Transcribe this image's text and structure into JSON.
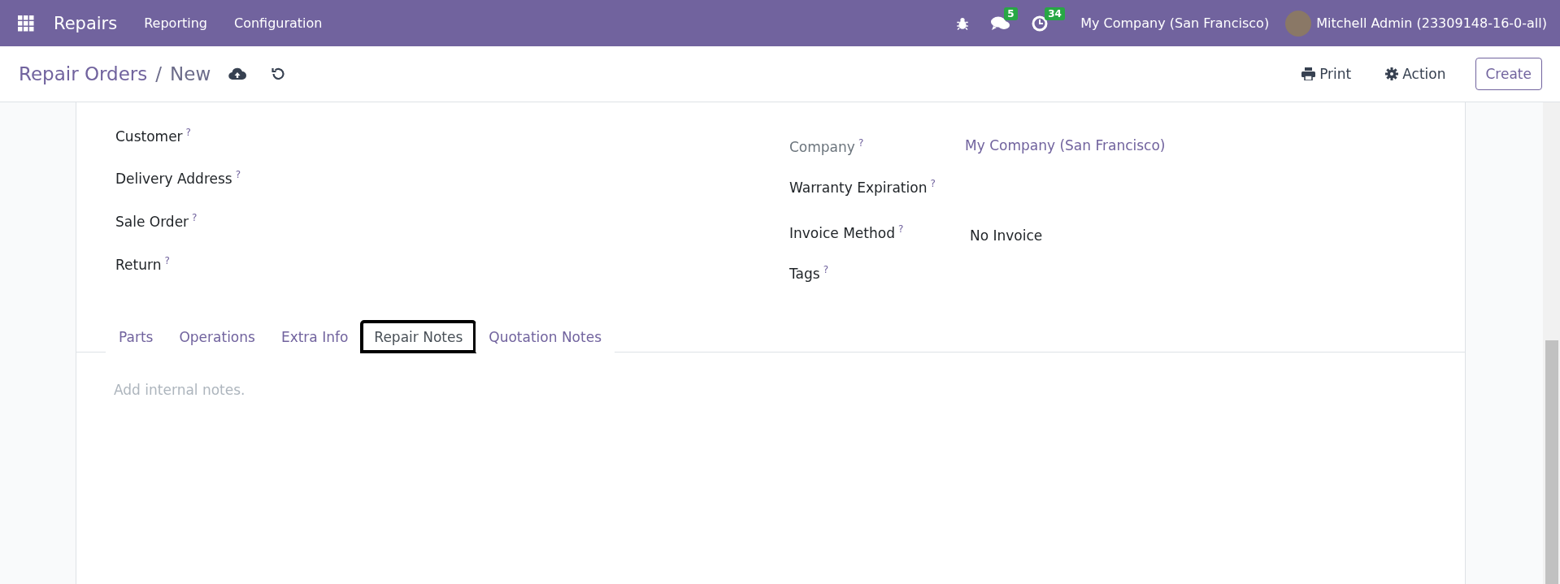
{
  "navbar": {
    "app": "Repairs",
    "menus": [
      "Reporting",
      "Configuration"
    ],
    "messages_count": "5",
    "activities_count": "34",
    "company": "My Company (San Francisco)",
    "user": "Mitchell Admin (23309148-16-0-all)"
  },
  "control_panel": {
    "breadcrumb": "Repair Orders",
    "separator": "/",
    "current": "New",
    "print": "Print",
    "action": "Action",
    "create": "Create"
  },
  "form": {
    "left_fields": [
      {
        "label": "Customer",
        "help": "?"
      },
      {
        "label": "Delivery Address",
        "help": "?"
      },
      {
        "label": "Sale Order",
        "help": "?"
      },
      {
        "label": "Return",
        "help": "?"
      }
    ],
    "right_fields": [
      {
        "label": "Company",
        "help": "?",
        "value": "My Company (San Francisco)",
        "kind": "link"
      },
      {
        "label": "Warranty Expiration",
        "help": "?",
        "kind": "empty"
      },
      {
        "label": "Invoice Method",
        "help": "?",
        "value": "No Invoice",
        "kind": "select"
      },
      {
        "label": "Tags",
        "help": "?",
        "kind": "empty"
      }
    ],
    "tabs": [
      {
        "label": "Parts",
        "selected": false,
        "highlighted": false
      },
      {
        "label": "Operations",
        "selected": false,
        "highlighted": false
      },
      {
        "label": "Extra Info",
        "selected": false,
        "highlighted": false
      },
      {
        "label": "Repair Notes",
        "selected": true,
        "highlighted": true
      },
      {
        "label": "Quotation Notes",
        "selected": false,
        "highlighted": false
      }
    ],
    "notes": {
      "placeholder": "Add internal notes."
    }
  }
}
